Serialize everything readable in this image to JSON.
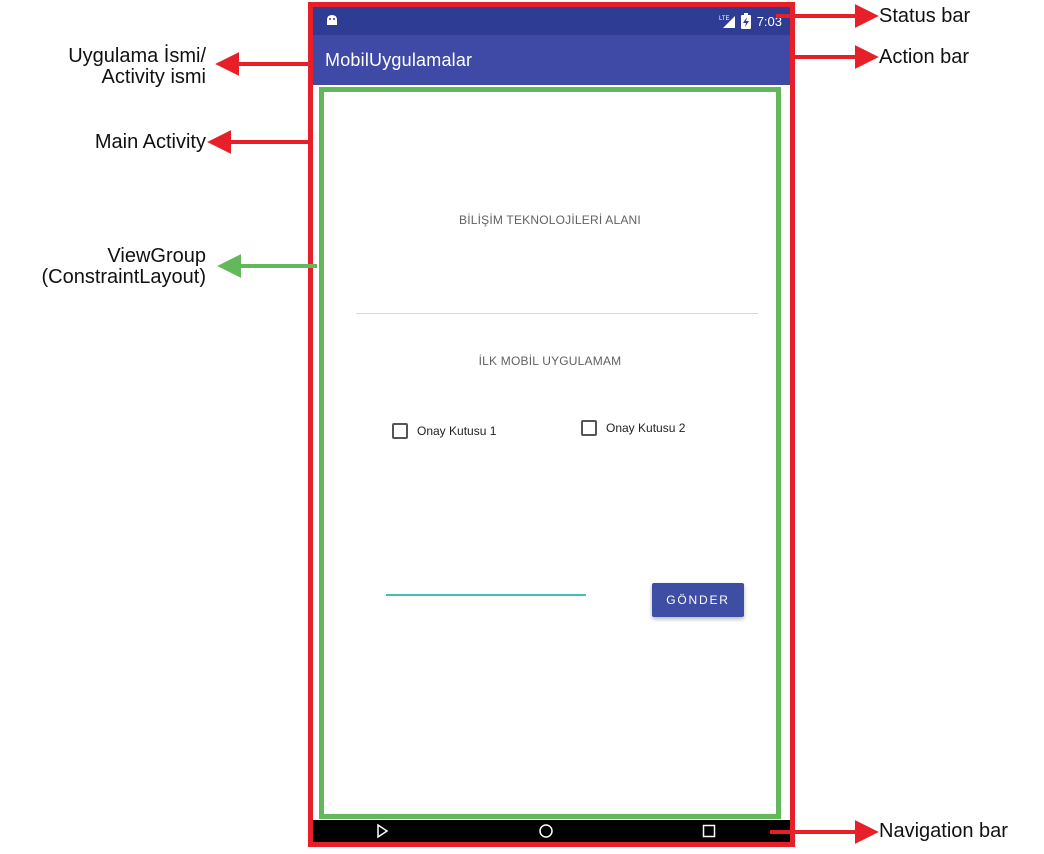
{
  "phone": {
    "app_name": "MobilUygulamalar",
    "status": {
      "network": "LTE",
      "time": "7:03",
      "icons": [
        "android-icon",
        "lte-signal-icon",
        "battery-charging-icon"
      ]
    },
    "content": {
      "title": "BİLİŞİM TEKNOLOJİLERİ ALANI",
      "subtitle": "İLK MOBİL UYGULAMAM",
      "checkboxes": [
        {
          "label": "Onay Kutusu 1",
          "checked": false
        },
        {
          "label": "Onay Kutusu 2",
          "checked": false
        }
      ],
      "input_value": "",
      "button_label": "GÖNDER"
    },
    "nav_icons": [
      "back-icon",
      "home-icon",
      "recents-icon"
    ]
  },
  "annotations": {
    "status_bar": "Status bar",
    "action_bar": "Action bar",
    "app_name_line1": "Uygulama İsmi/",
    "app_name_line2": "Activity ismi",
    "main_activity": "Main Activity",
    "viewgroup_line1": "ViewGroup",
    "viewgroup_line2": "(ConstraintLayout)",
    "navigation_bar": "Navigation bar"
  },
  "colors": {
    "annotation_red": "#e71f29",
    "annotation_green": "#63b85c",
    "status_bar": "#2f3c94",
    "action_bar": "#3e4aa6",
    "button": "#3f4ea5",
    "input_underline": "#3ec1b6"
  }
}
